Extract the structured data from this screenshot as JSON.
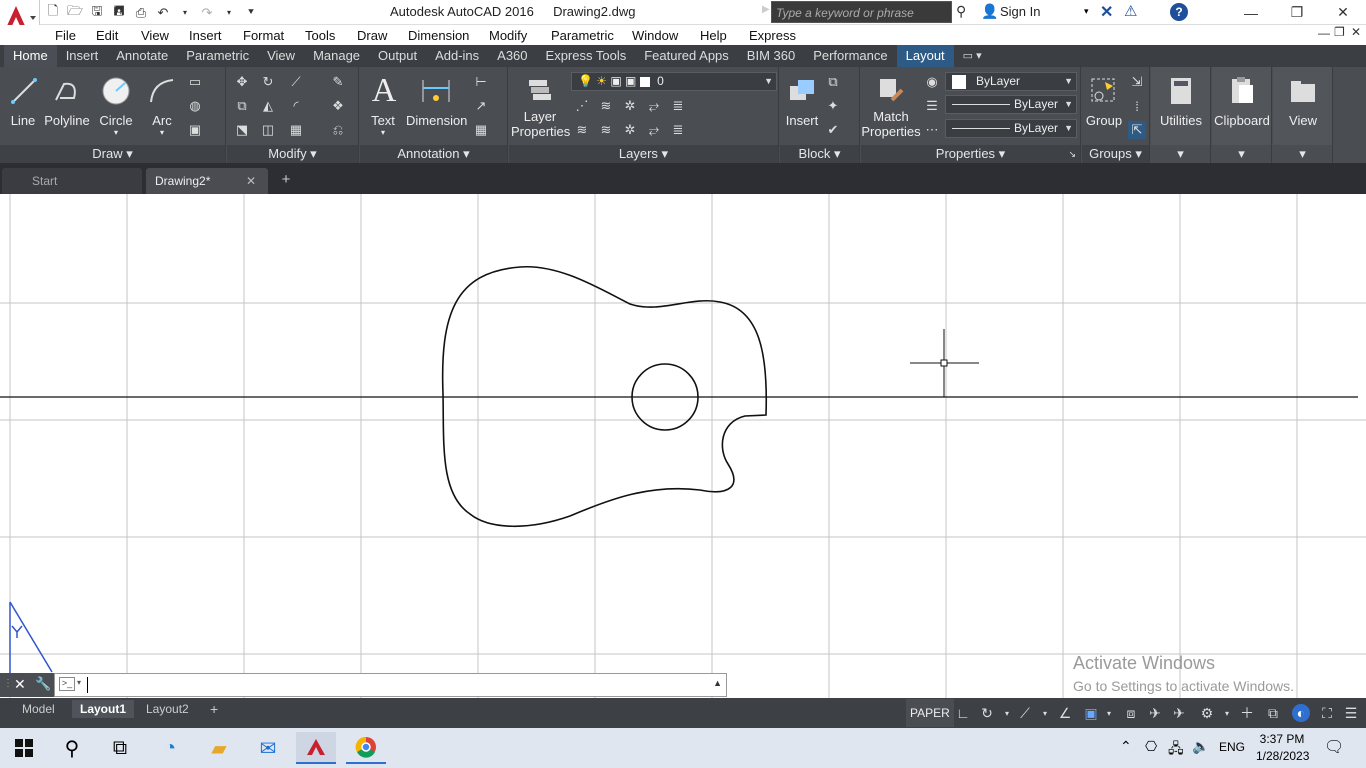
{
  "titlebar": {
    "app_title": "Autodesk AutoCAD 2016",
    "doc_title": "Drawing2.dwg",
    "search_placeholder": "Type a keyword or phrase",
    "sign_in": "Sign In"
  },
  "menubar": [
    "File",
    "Edit",
    "View",
    "Insert",
    "Format",
    "Tools",
    "Draw",
    "Dimension",
    "Modify",
    "Parametric",
    "Window",
    "Help",
    "Express"
  ],
  "ribbon_tabs": [
    "Home",
    "Insert",
    "Annotate",
    "Parametric",
    "View",
    "Manage",
    "Output",
    "Add-ins",
    "A360",
    "Express Tools",
    "Featured Apps",
    "BIM 360",
    "Performance",
    "Layout"
  ],
  "ribbon": {
    "draw": {
      "title": "Draw",
      "line": "Line",
      "polyline": "Polyline",
      "circle": "Circle",
      "arc": "Arc"
    },
    "modify": {
      "title": "Modify"
    },
    "annotation": {
      "title": "Annotation",
      "text": "Text",
      "dimension": "Dimension"
    },
    "layers": {
      "title": "Layers",
      "layer_properties": "Layer Properties",
      "current_layer": "0"
    },
    "block": {
      "title": "Block",
      "insert": "Insert"
    },
    "properties": {
      "title": "Properties",
      "match": "Match Properties",
      "color": "ByLayer",
      "linetype": "ByLayer",
      "lineweight": "ByLayer"
    },
    "groups": {
      "title": "Groups",
      "group": "Group"
    },
    "utilities": "Utilities",
    "clipboard": "Clipboard",
    "view": "View"
  },
  "file_tabs": {
    "start": "Start",
    "drawing": "Drawing2*"
  },
  "watermark": {
    "line1": "Activate Windows",
    "line2": "Go to Settings to activate Windows."
  },
  "layout_tabs": [
    "Model",
    "Layout1",
    "Layout2"
  ],
  "status": {
    "paper": "PAPER"
  },
  "taskbar": {
    "time": "3:37 PM",
    "date": "1/28/2023",
    "lang": "ENG"
  }
}
